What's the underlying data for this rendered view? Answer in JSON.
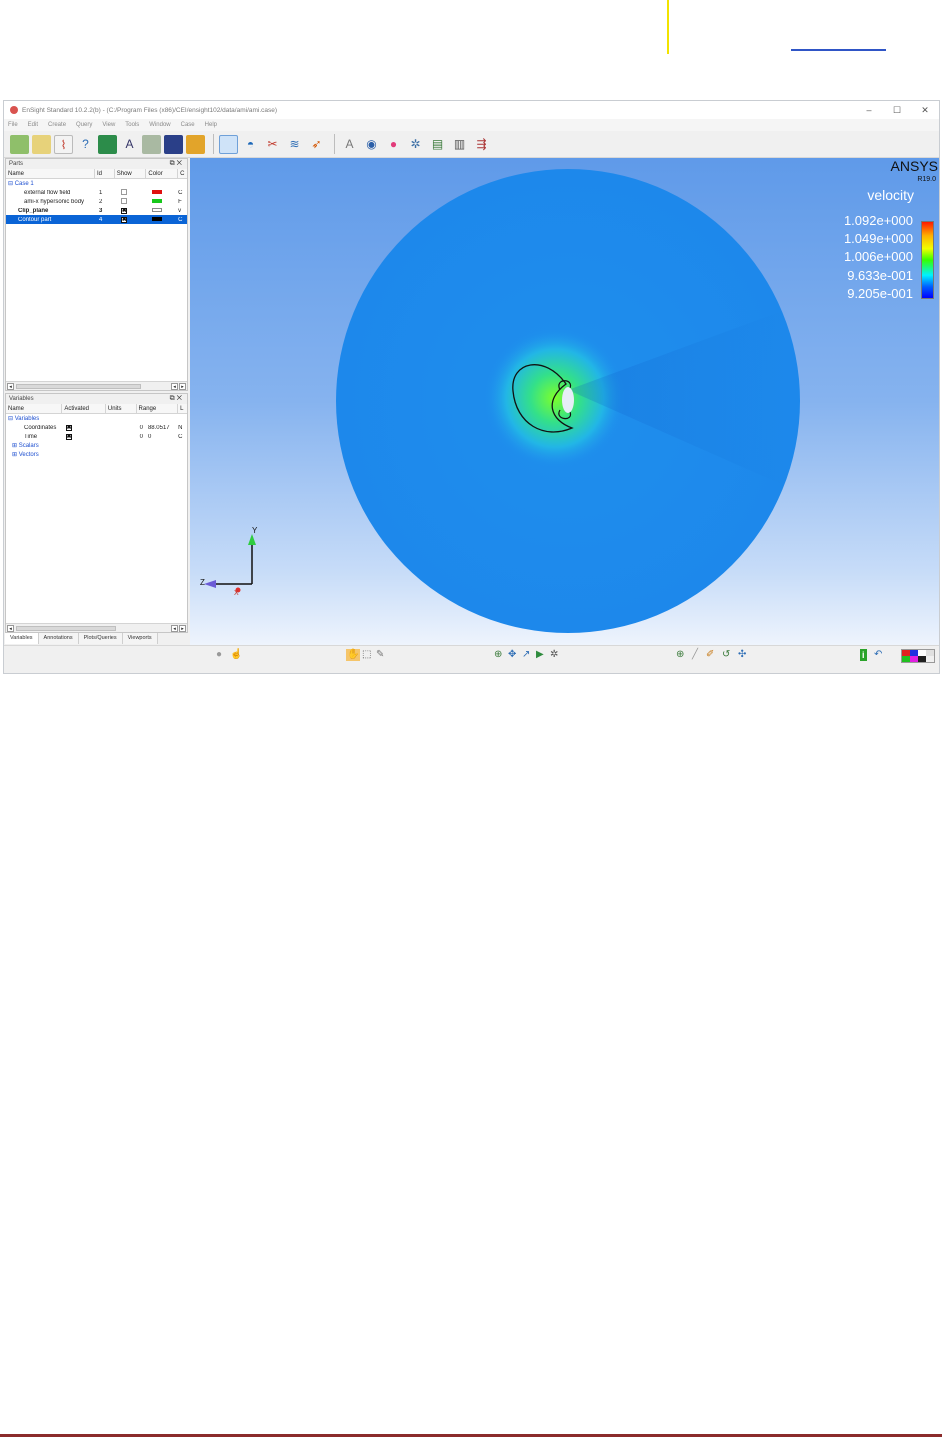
{
  "window": {
    "title": "EnSight Standard 10.2.2(b) - (C:/Program Files (x86)/CEI/ensight102/data/ami/ami.case)",
    "min": "–",
    "max": "☐",
    "close": "✕"
  },
  "menu": [
    "File",
    "Edit",
    "Create",
    "Query",
    "View",
    "Tools",
    "Window",
    "Case",
    "Help"
  ],
  "parts": {
    "title": "Parts",
    "columns": [
      "Name",
      "Id",
      "Show",
      "Color",
      "C"
    ],
    "rows": [
      {
        "name": "Case 1",
        "id": "",
        "show": "",
        "color": "",
        "extra": ""
      },
      {
        "name": "external flow field",
        "id": "1",
        "show": "",
        "color": "#e01010",
        "extra": "C"
      },
      {
        "name": "ami-x hypersonic body",
        "id": "2",
        "show": "",
        "color": "#18c81c",
        "extra": "F"
      },
      {
        "name": "Clip_plane",
        "id": "3",
        "show": "✖",
        "color": "#ffffff",
        "extra": "v"
      },
      {
        "name": "Contour part",
        "id": "4",
        "show": "✖",
        "color": "#000000",
        "extra": "C"
      }
    ]
  },
  "variables": {
    "title": "Variables",
    "columns": [
      "Name",
      "Activated",
      "Units",
      "Range",
      "L"
    ],
    "rows": [
      {
        "name": "Variables",
        "act": "",
        "units": "",
        "range": ""
      },
      {
        "name": "Coordinates",
        "act": "✖",
        "units": "",
        "range": "0   88.0517",
        "extra": "N"
      },
      {
        "name": "Time",
        "act": "✖",
        "units": "",
        "range": "0   0",
        "extra": "C"
      },
      {
        "name": "Scalars",
        "act": "",
        "units": "",
        "range": ""
      },
      {
        "name": "Vectors",
        "act": "",
        "units": "",
        "range": ""
      }
    ]
  },
  "tabs": [
    "Variables",
    "Annotations",
    "Plots/Queries",
    "Viewports"
  ],
  "viewport": {
    "brand": "ANSYS",
    "version": "R19.0",
    "legend_title": "velocity",
    "legend_values": [
      "1.092e+000",
      "1.049e+000",
      "1.006e+000",
      "9.633e-001",
      "9.205e-001"
    ],
    "axis_labels": {
      "y": "Y",
      "z": "Z",
      "x": "X"
    }
  },
  "colors": {
    "accent": "#0a64d6",
    "disk": "#1e90ee"
  }
}
